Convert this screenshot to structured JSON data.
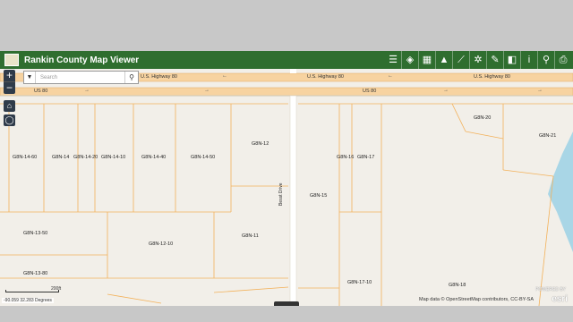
{
  "app": {
    "title": "Rankin County Map Viewer"
  },
  "toolbar": {
    "tools": [
      {
        "name": "legend-icon",
        "glyph": "☰"
      },
      {
        "name": "layers-icon",
        "glyph": "◈"
      },
      {
        "name": "basemap-gallery-icon",
        "glyph": "▦"
      },
      {
        "name": "warning-icon",
        "glyph": "▲"
      },
      {
        "name": "measure-icon",
        "glyph": "⟋"
      },
      {
        "name": "query-icon",
        "glyph": "✲"
      },
      {
        "name": "draw-icon",
        "glyph": "✎"
      },
      {
        "name": "panel-icon",
        "glyph": "◧"
      },
      {
        "name": "about-icon",
        "glyph": "i"
      },
      {
        "name": "share-icon",
        "glyph": "⚲"
      },
      {
        "name": "print-icon",
        "glyph": "⎙"
      }
    ]
  },
  "search": {
    "placeholder": "Search"
  },
  "map": {
    "roads": {
      "highway": "U.S. Highway 80",
      "us80": "US 80",
      "besst": "Besst Drive"
    },
    "parcels": [
      "G8N-14-60",
      "G8N-14",
      "G8N-14-20",
      "G8N-14-10",
      "G8N-14-40",
      "G8N-14-50",
      "G8N-12",
      "G8N-16",
      "G8N-17",
      "G8N-15",
      "G8N-20",
      "G8N-21",
      "G8N-13-50",
      "G8N-12-10",
      "G8N-11",
      "G8N-13-80",
      "G8N-17-10",
      "G8N-18"
    ],
    "scale_label": "200ft",
    "coordinates": "-90.059 32.283 Degrees",
    "attribution": "Map data © OpenStreetMap contributors, CC-BY-SA",
    "esri_powered": "POWERED BY",
    "esri_logo": "esri"
  },
  "colors": {
    "header": "#2f6e2f",
    "highway": "#f7d3a1",
    "parcel_line": "#f3b15a",
    "land": "#f2efe9",
    "water": "#a9d6e6"
  }
}
